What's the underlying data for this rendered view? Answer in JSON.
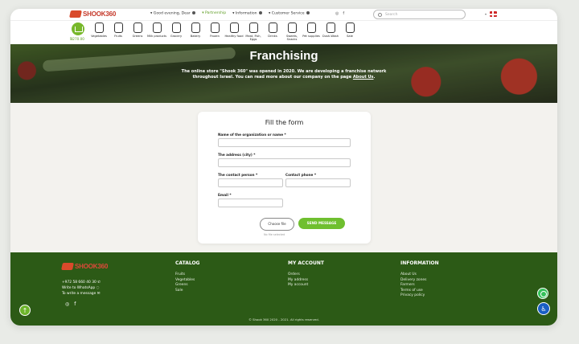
{
  "header": {
    "logo_text": "SHOOK360",
    "greeting": "Good evening, Dear",
    "partnership": "Partnership",
    "information": "Information",
    "customer_service": "Customer Service",
    "search_placeholder": "Search"
  },
  "cart": {
    "total": "₪270.00"
  },
  "categories": [
    {
      "label": "Vegetables"
    },
    {
      "label": "Fruits"
    },
    {
      "label": "Greens"
    },
    {
      "label": "Milk products"
    },
    {
      "label": "Grocery"
    },
    {
      "label": "Bakery"
    },
    {
      "label": "Frozen"
    },
    {
      "label": "Healthy food"
    },
    {
      "label": "Meat, Fish, Eggs"
    },
    {
      "label": "Drinks"
    },
    {
      "label": "Sweets, Snacks"
    },
    {
      "label": "Pet supplies"
    },
    {
      "label": "Dush-Wash"
    },
    {
      "label": "Sale"
    }
  ],
  "banner": {
    "title": "Franchising",
    "text": "The online store \"Shook 360\" was opened in 2020. We are developing a franchise network throughout Israel. You can read more about our company on the page",
    "link": "About Us",
    "link_suffix": "."
  },
  "form": {
    "title": "Fill the form",
    "org_label": "Name of the organization or name *",
    "address_label": "The address (city) *",
    "contact_label": "The contact person *",
    "phone_label": "Contact phone *",
    "email_label": "Email *",
    "choose_label": "Choose file",
    "no_file": "No file selected",
    "send_label": "SEND MESSAGE"
  },
  "footer": {
    "logo_text": "SHOOK360",
    "phone": "+972 58 660 40 30",
    "whatsapp": "Write to WhatsApp",
    "message": "To write a message",
    "catalog": {
      "title": "CATALOG",
      "items": [
        "Fruits",
        "Vegetables",
        "Greens",
        "Sale"
      ]
    },
    "account": {
      "title": "MY ACCOUNT",
      "items": [
        "Orders",
        "My address",
        "My account"
      ]
    },
    "information": {
      "title": "INFORMATION",
      "items": [
        "About Us",
        "Delivery zones",
        "Farmers",
        "Terms of use",
        "Privacy policy"
      ]
    },
    "copyright": "© Shook 360 2020 - 2021. All rights reserved."
  },
  "colors": {
    "brand_green": "#6fbf2f",
    "footer_green": "#2c5a16",
    "logo_red": "#c5392a"
  }
}
